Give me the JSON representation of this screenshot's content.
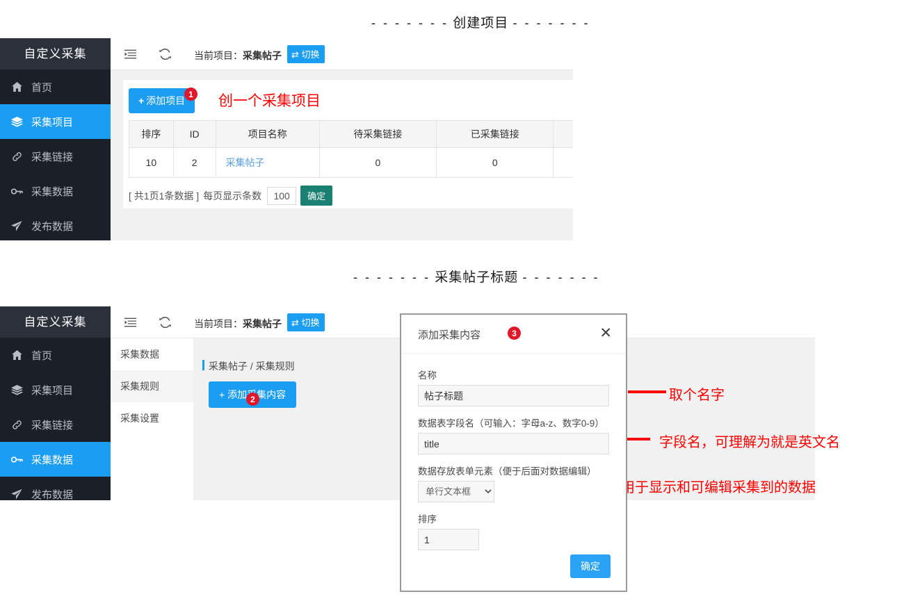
{
  "sections": [
    {
      "id": "s1",
      "dash_left": "- - - - - - -",
      "label": "创建项目",
      "dash_right": "- - - - - - -"
    },
    {
      "id": "s2",
      "dash_left": "- - - - - - -",
      "label": "采集帖子标题",
      "dash_right": "- - - - - - -"
    }
  ],
  "brand": "自定义采集",
  "sidebar": {
    "items": [
      {
        "label": "首页",
        "icon": "home-icon"
      },
      {
        "label": "采集项目",
        "icon": "layers-icon"
      },
      {
        "label": "采集链接",
        "icon": "link-icon"
      },
      {
        "label": "采集数据",
        "icon": "key-icon"
      },
      {
        "label": "发布数据",
        "icon": "send-icon"
      }
    ],
    "active_top": "采集项目",
    "active_bottom": "采集数据"
  },
  "topbar": {
    "collapse_icon": "collapse-menu-icon",
    "refresh_icon": "refresh-icon",
    "current_project_label": "当前项目：",
    "current_project_name": "采集帖子",
    "switch_button": "⇄ 切换"
  },
  "panel1": {
    "add_button": "添加项目",
    "add_button_plus": "+",
    "red_tip": "创一个采集项目",
    "badge": "1",
    "table": {
      "headers": [
        "排序",
        "ID",
        "项目名称",
        "待采集链接",
        "已采集链接",
        ""
      ],
      "rows": [
        [
          "10",
          "2",
          "采集帖子",
          "0",
          "0",
          ""
        ]
      ]
    },
    "pager": {
      "summary": "[ 共1页1条数据 ]",
      "per_page_label": "每页显示条数",
      "per_page_value": "100",
      "confirm": "确定"
    }
  },
  "panel2": {
    "subnav": [
      {
        "label": "采集数据"
      },
      {
        "label": "采集规则"
      },
      {
        "label": "采集设置"
      }
    ],
    "subnav_active": "采集规则",
    "breadcrumb": "采集帖子 / 采集规则",
    "add_button": "+ 添加采集内容",
    "badge": "2"
  },
  "modal": {
    "title": "添加采集内容",
    "badge": "3",
    "close_icon": "close-icon",
    "fields": {
      "name_label": "名称",
      "name_value": "帖子标题",
      "field_label": "数据表字段名",
      "field_hint": "（可输入：字母a-z、数字0-9）",
      "field_value": "title",
      "element_label": "数据存放表单元素",
      "element_hint": "（便于后面对数据编辑）",
      "element_value": "单行文本框",
      "element_options": [
        "单行文本框"
      ],
      "sort_label": "排序",
      "sort_value": "1"
    },
    "confirm": "确定"
  },
  "annotations": [
    {
      "text": "取个名字"
    },
    {
      "text": "字段名，可理解为就是英文名"
    },
    {
      "text": "表单元素，用于显示和可编辑采集到的数据"
    }
  ],
  "colors": {
    "accent_blue": "#1b9df1",
    "modal_ok_blue": "#2aa3f7",
    "sidebar_dark": "#1b1f27",
    "brand_dark": "#2b303b",
    "badge_red": "#e0162b",
    "annotation_red": "#ff0000",
    "pager_green": "#1a8071",
    "panel_gray": "#f1f1f1"
  }
}
